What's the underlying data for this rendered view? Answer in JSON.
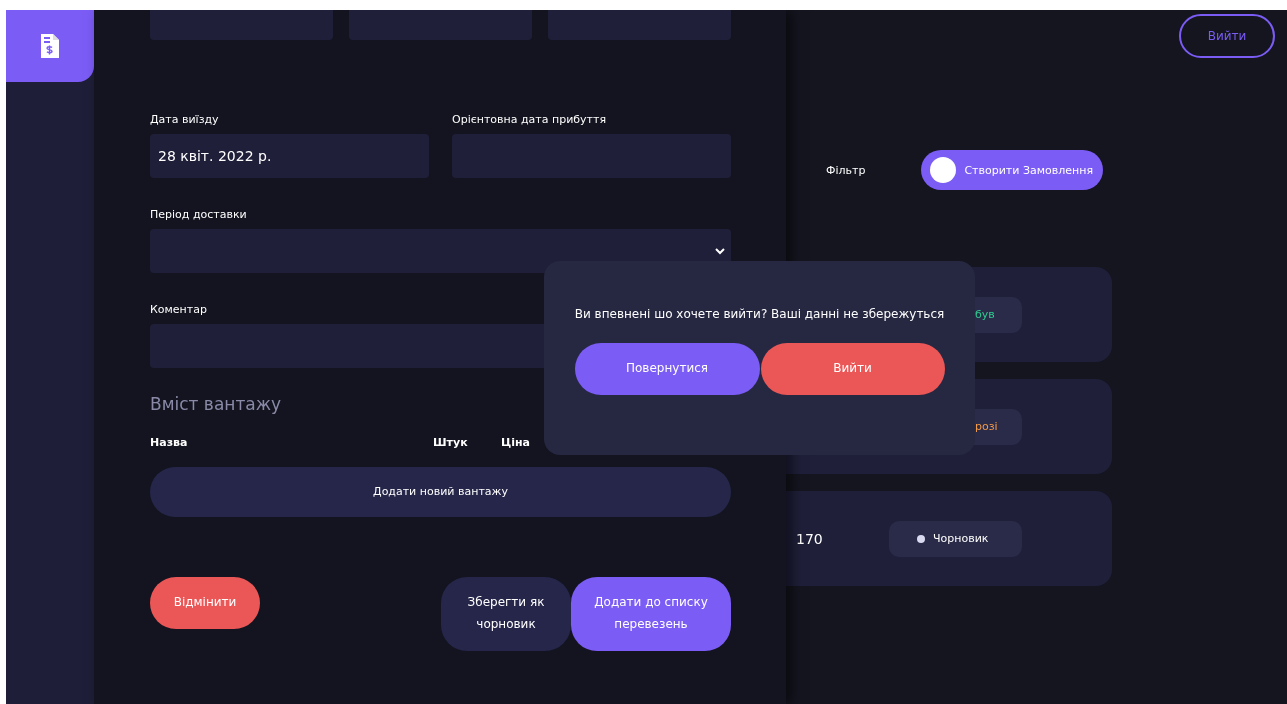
{
  "sidebar": {
    "items": [
      {
        "selected": true
      }
    ]
  },
  "form": {
    "departure": {
      "label": "Дата виїзду",
      "value": "28 квіт. 2022 р."
    },
    "arrival": {
      "label": "Орієнтовна дата прибуття"
    },
    "period": {
      "label": "Період доставки"
    },
    "comment": {
      "label": "Коментар"
    },
    "cargo_title": "Вміст вантажу",
    "cargo_columns": [
      "Назва",
      "Штук",
      "Ціна"
    ],
    "add_cargo": "Додати новий вантажу",
    "cancel": "Відмінити",
    "save_draft": "Зберегти як чорновик",
    "submit": "Додати до списку перевезень"
  },
  "header": {
    "logout": "Вийти",
    "filter": "Фільтр",
    "create": "Створити Замовлення"
  },
  "orders": [
    {
      "status": "був",
      "kind": "cut",
      "color": "#2ecc8f"
    },
    {
      "status": "розі",
      "kind": "cut",
      "color": "#f2994a"
    },
    {
      "number": "170",
      "status": "Чорновик",
      "kind": "full",
      "color": "#d9d9f0"
    }
  ],
  "dialog": {
    "message": "Ви впевнені шо хочете вийти? Ваші данні не збережуться",
    "back": "Повернутися",
    "exit": "Вийти"
  }
}
